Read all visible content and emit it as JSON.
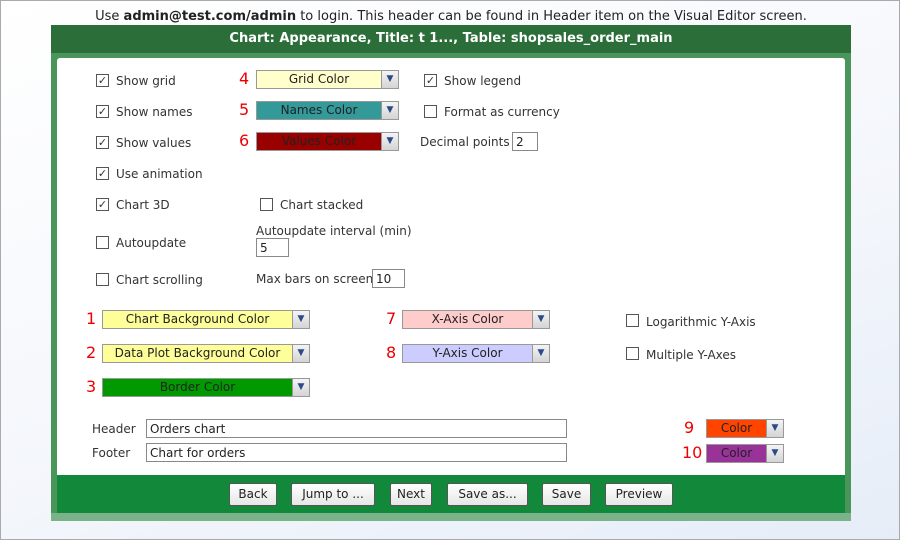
{
  "note": {
    "pre": "Use ",
    "bold": "admin@test.com/admin",
    "post": " to login. This header can be found in Header item on the Visual Editor screen."
  },
  "title": "Chart: Appearance, Title: t 1..., Table: shopsales_order_main",
  "options": {
    "show_grid": {
      "label": "Show grid",
      "checked": true
    },
    "show_names": {
      "label": "Show names",
      "checked": true
    },
    "show_values": {
      "label": "Show values",
      "checked": true
    },
    "use_animation": {
      "label": "Use animation",
      "checked": true
    },
    "chart_3d": {
      "label": "Chart 3D",
      "checked": true
    },
    "autoupdate": {
      "label": "Autoupdate",
      "checked": false
    },
    "chart_scrolling": {
      "label": "Chart scrolling",
      "checked": false
    },
    "show_legend": {
      "label": "Show legend",
      "checked": true
    },
    "format_currency": {
      "label": "Format as currency",
      "checked": false
    },
    "chart_stacked": {
      "label": "Chart stacked",
      "checked": false
    },
    "log_y": {
      "label": "Logarithmic Y-Axis",
      "checked": false
    },
    "multi_y": {
      "label": "Multiple Y-Axes",
      "checked": false
    }
  },
  "decimal_points": {
    "label": "Decimal points",
    "value": "2"
  },
  "autoupdate_interval": {
    "label": "Autoupdate interval (min)",
    "value": "5"
  },
  "max_bars": {
    "label": "Max bars on screen",
    "value": "10"
  },
  "colors": [
    {
      "num": "1",
      "label": "Chart Background Color",
      "color": "#ffff99"
    },
    {
      "num": "2",
      "label": "Data Plot Background Color",
      "color": "#ffff99"
    },
    {
      "num": "3",
      "label": "Border Color",
      "color": "#009900"
    },
    {
      "num": "4",
      "label": "Grid Color",
      "color": "#ffffcc"
    },
    {
      "num": "5",
      "label": "Names Color",
      "color": "#339999"
    },
    {
      "num": "6",
      "label": "Values Color",
      "color": "#990000"
    },
    {
      "num": "7",
      "label": "X-Axis Color",
      "color": "#ffcccc"
    },
    {
      "num": "8",
      "label": "Y-Axis Color",
      "color": "#ccccff"
    },
    {
      "num": "9",
      "label": "Color",
      "color": "#ff4400"
    },
    {
      "num": "10",
      "label": "Color",
      "color": "#993399"
    }
  ],
  "header": {
    "label": "Header",
    "value": "Orders chart"
  },
  "footer": {
    "label": "Footer",
    "value": "Chart for orders"
  },
  "buttons": {
    "back": "Back",
    "jump": "Jump to ...",
    "next": "Next",
    "save_as": "Save as...",
    "save": "Save",
    "preview": "Preview"
  }
}
